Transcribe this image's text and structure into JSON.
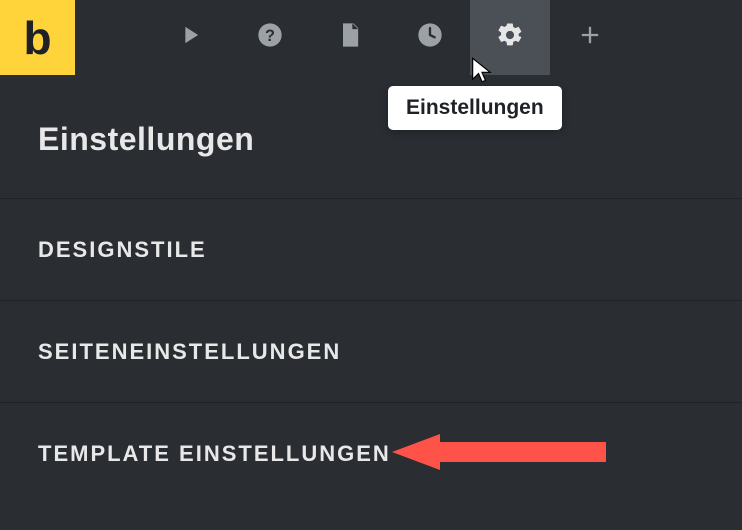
{
  "logo": {
    "letter": "b"
  },
  "header": {
    "title": "Einstellungen"
  },
  "toolbar": {
    "tooltip": "Einstellungen"
  },
  "menu": {
    "items": [
      {
        "label": "Designstile"
      },
      {
        "label": "Seiteneinstellungen"
      },
      {
        "label": "Template Einstellungen"
      }
    ]
  }
}
